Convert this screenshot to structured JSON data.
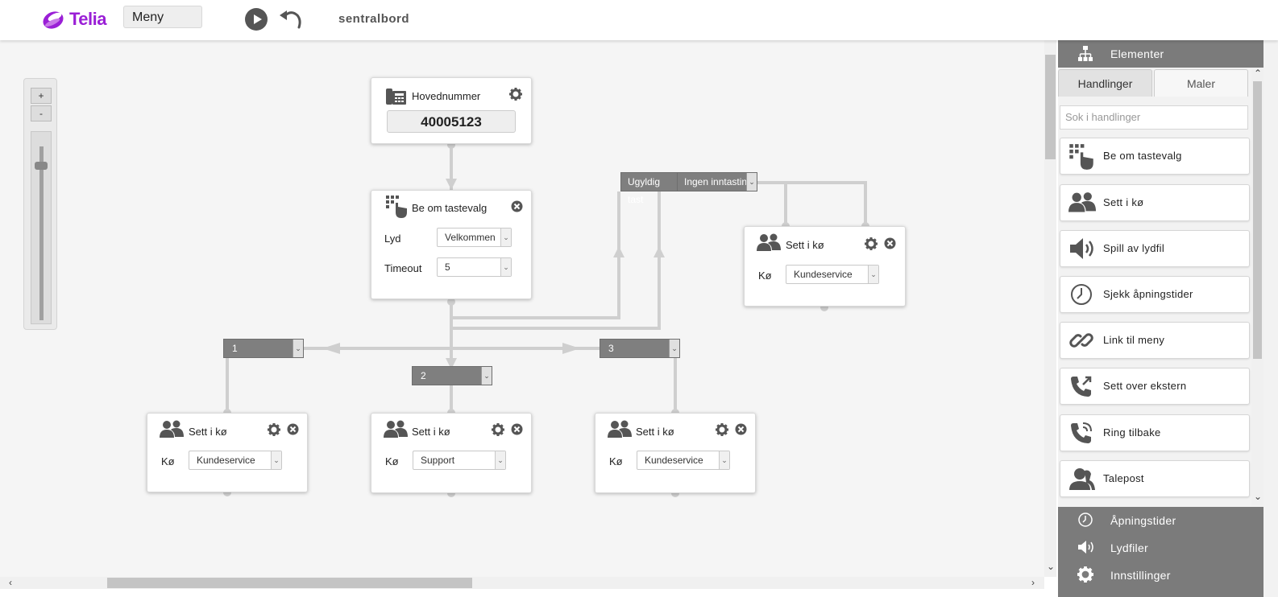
{
  "header": {
    "brand": "Telia",
    "menu_value": "Meny",
    "title": "sentralbord"
  },
  "zoom": {
    "plus": "+",
    "minus": "-"
  },
  "nodes": {
    "main": {
      "title": "Hovednummer",
      "number": "40005123"
    },
    "menu": {
      "title": "Be om tastevalg",
      "lyd_label": "Lyd",
      "lyd_value": "Velkommen",
      "timeout_label": "Timeout",
      "timeout_value": "5"
    },
    "queue_right": {
      "title": "Sett i kø",
      "label": "Kø",
      "value": "Kundeservice"
    },
    "queue_1": {
      "title": "Sett i kø",
      "label": "Kø",
      "value": "Kundeservice"
    },
    "queue_2": {
      "title": "Sett i kø",
      "label": "Kø",
      "value": "Support"
    },
    "queue_3": {
      "title": "Sett i kø",
      "label": "Kø",
      "value": "Kundeservice"
    }
  },
  "branches": {
    "b1": "1",
    "b2": "2",
    "b3": "3",
    "invalid": "Ugyldig tast",
    "no_input": "Ingen inntastin"
  },
  "panel": {
    "elements": "Elementer",
    "tabs": [
      "Handlinger",
      "Maler"
    ],
    "search_placeholder": "Sok i handlinger",
    "actions": [
      {
        "label": "Be om tastevalg",
        "icon": "keypad-hand-icon"
      },
      {
        "label": "Sett i kø",
        "icon": "people-icon"
      },
      {
        "label": "Spill av lydfil",
        "icon": "speaker-icon"
      },
      {
        "label": "Sjekk åpningstider",
        "icon": "clock-icon"
      },
      {
        "label": "Link til meny",
        "icon": "link-icon"
      },
      {
        "label": "Sett over ekstern",
        "icon": "phone-forward-icon"
      },
      {
        "label": "Ring tilbake",
        "icon": "phone-callback-icon"
      },
      {
        "label": "Talepost",
        "icon": "person-icon"
      }
    ],
    "sections": {
      "hours": "Åpningstider",
      "audio": "Lydfiler",
      "settings": "Innstillinger"
    }
  },
  "colors": {
    "brand": "#9a1fd6",
    "panel_header": "#7b7b7b",
    "branch": "#7f7f7f",
    "connector": "#cfcfcf"
  }
}
